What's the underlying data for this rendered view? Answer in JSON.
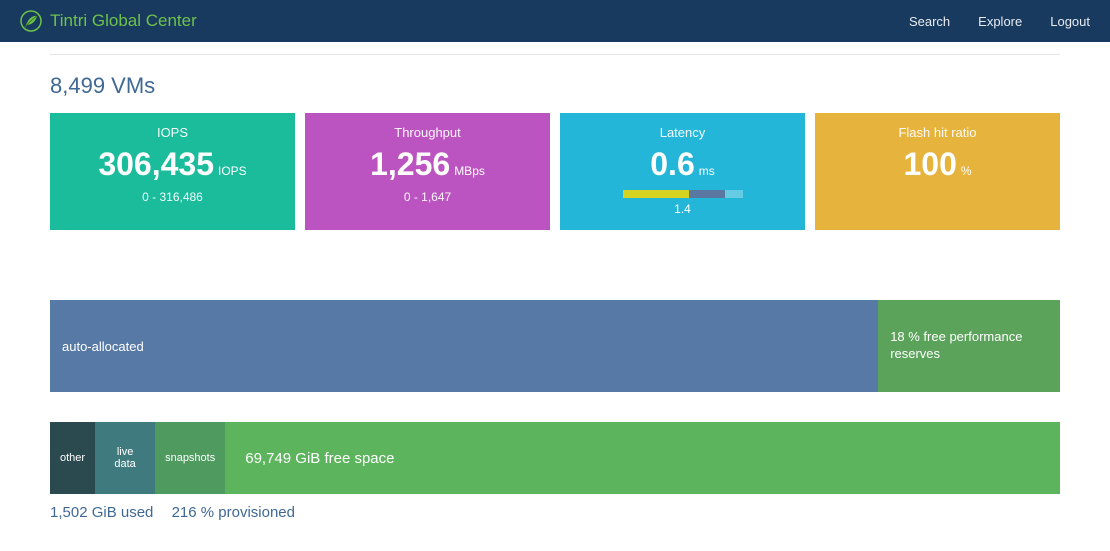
{
  "brand": "Tintri Global Center",
  "nav": {
    "search": "Search",
    "explore": "Explore",
    "logout": "Logout"
  },
  "vm_count": "8,499 VMs",
  "cards": {
    "iops": {
      "title": "IOPS",
      "value": "306,435",
      "unit": "IOPS",
      "range": "0 - 316,486"
    },
    "thru": {
      "title": "Throughput",
      "value": "1,256",
      "unit": "MBps",
      "range": "0 - 1,647"
    },
    "lat": {
      "title": "Latency",
      "value": "0.6",
      "unit": "ms",
      "bar_value": "1.4"
    },
    "flash": {
      "title": "Flash hit ratio",
      "value": "100",
      "unit": "%"
    }
  },
  "perf": {
    "auto": "auto-allocated",
    "free": "18 % free performance reserves"
  },
  "space": {
    "other": "other",
    "live": "live data",
    "snap": "snapshots",
    "free": "69,749 GiB free space",
    "used": "1,502 GiB used",
    "prov": "216 % provisioned"
  },
  "chart_data": [
    {
      "type": "bar",
      "title": "Performance reserve allocation",
      "series": [
        {
          "name": "auto-allocated",
          "value": 82
        },
        {
          "name": "free performance reserves",
          "value": 18
        }
      ],
      "unit": "%"
    },
    {
      "type": "bar",
      "title": "Storage space",
      "series": [
        {
          "name": "other",
          "value_gib": 200
        },
        {
          "name": "live data",
          "value_gib": 650
        },
        {
          "name": "snapshots",
          "value_gib": 652
        },
        {
          "name": "free space",
          "value_gib": 69749
        }
      ],
      "used_gib": 1502,
      "provisioned_pct": 216
    },
    {
      "type": "bar",
      "title": "Latency breakdown",
      "total_ms": 1.4,
      "series": [
        {
          "name": "segment-1",
          "value": 0.77
        },
        {
          "name": "segment-2",
          "value": 0.42
        }
      ]
    }
  ]
}
